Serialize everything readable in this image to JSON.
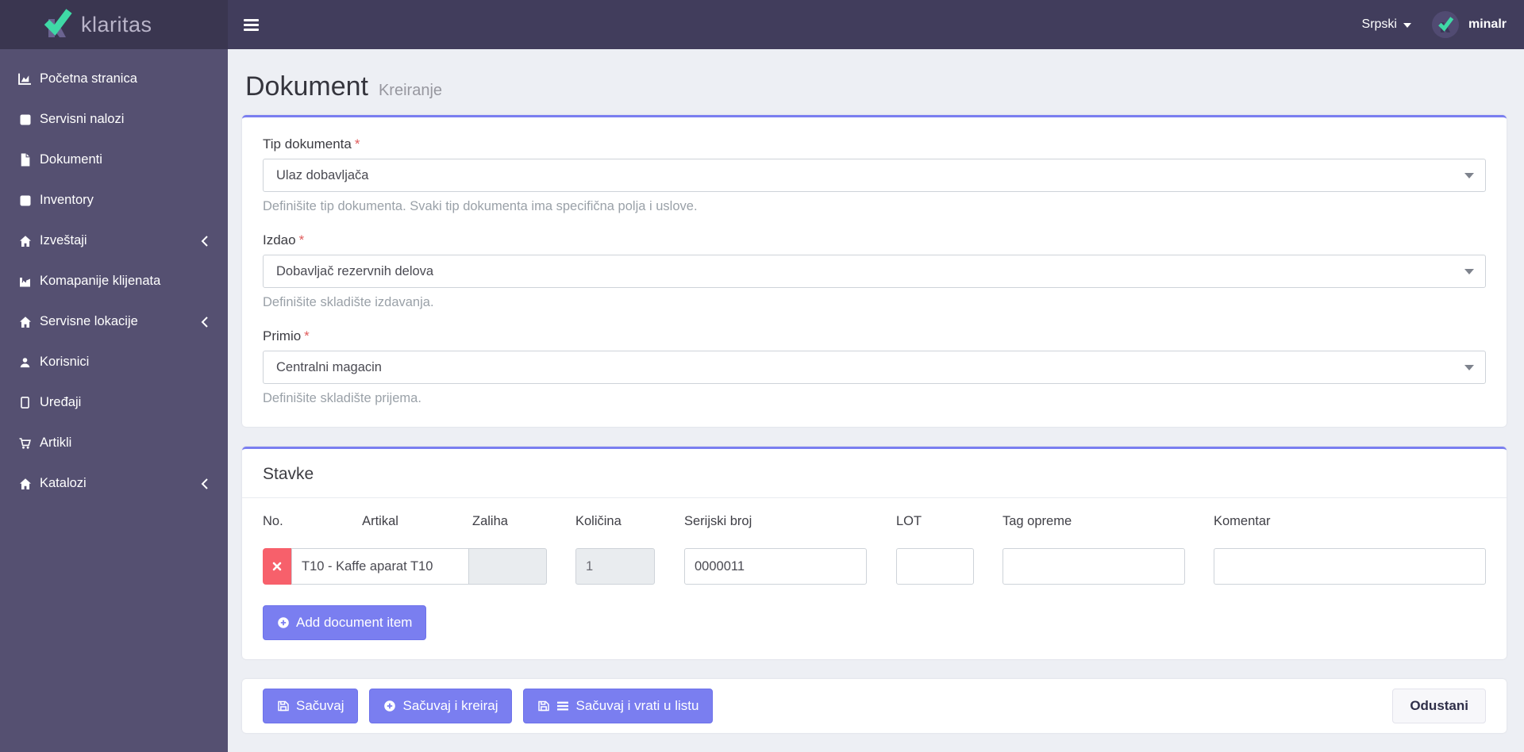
{
  "brand": {
    "name": "klaritas"
  },
  "topbar": {
    "language": "Srpski",
    "username": "minalr"
  },
  "sidebar": {
    "items": [
      {
        "label": "Početna stranica",
        "icon": "chart-area-icon",
        "expandable": false
      },
      {
        "label": "Servisni nalozi",
        "icon": "square-icon",
        "expandable": false
      },
      {
        "label": "Dokumenti",
        "icon": "file-icon",
        "expandable": false
      },
      {
        "label": "Inventory",
        "icon": "square-icon",
        "expandable": false
      },
      {
        "label": "Izveštaji",
        "icon": "home-icon",
        "expandable": true
      },
      {
        "label": "Komapanije klijenata",
        "icon": "industry-icon",
        "expandable": false
      },
      {
        "label": "Servisne lokacije",
        "icon": "home-icon",
        "expandable": true
      },
      {
        "label": "Korisnici",
        "icon": "user-icon",
        "expandable": false
      },
      {
        "label": "Uređaji",
        "icon": "tablet-icon",
        "expandable": false
      },
      {
        "label": "Artikli",
        "icon": "cart-icon",
        "expandable": false
      },
      {
        "label": "Katalozi",
        "icon": "home-icon",
        "expandable": true
      }
    ]
  },
  "page": {
    "title": "Dokument",
    "subtitle": "Kreiranje"
  },
  "form": {
    "fields": [
      {
        "label": "Tip dokumenta",
        "required": "*",
        "value": "Ulaz dobavljača",
        "helper": "Definišite tip dokumenta. Svaki tip dokumenta ima specifična polja i uslove."
      },
      {
        "label": "Izdao",
        "required": "*",
        "value": "Dobavljač rezervnih delova",
        "helper": "Definišite skladište izdavanja."
      },
      {
        "label": "Primio",
        "required": "*",
        "value": "Centralni magacin",
        "helper": "Definišite skladište prijema."
      }
    ]
  },
  "items_section": {
    "title": "Stavke",
    "columns": [
      "No.",
      "Artikal",
      "Zaliha",
      "Količina",
      "Serijski broj",
      "LOT",
      "Tag opreme",
      "Komentar"
    ],
    "row": {
      "artikal": "T10 - Kaffe aparat T10",
      "zaliha": "",
      "kolicina": "1",
      "serijski_broj": "0000011",
      "lot": "",
      "tag_opreme": "",
      "komentar": ""
    },
    "add_button": "Add document item"
  },
  "footer": {
    "save": "Sačuvaj",
    "save_and_create": "Sačuvaj i kreiraj",
    "save_and_back": "Sačuvaj i vrati u listu",
    "cancel": "Odustani"
  },
  "colors": {
    "accent": "#7a7ef0",
    "danger": "#f7606b",
    "topbar": "#413d5c",
    "brand_area": "#3a3650",
    "sidebar": "#555071",
    "logo_teal": "#3fd9a6",
    "content_bg": "#edeff4",
    "disabled_input": "#e9ecef"
  }
}
